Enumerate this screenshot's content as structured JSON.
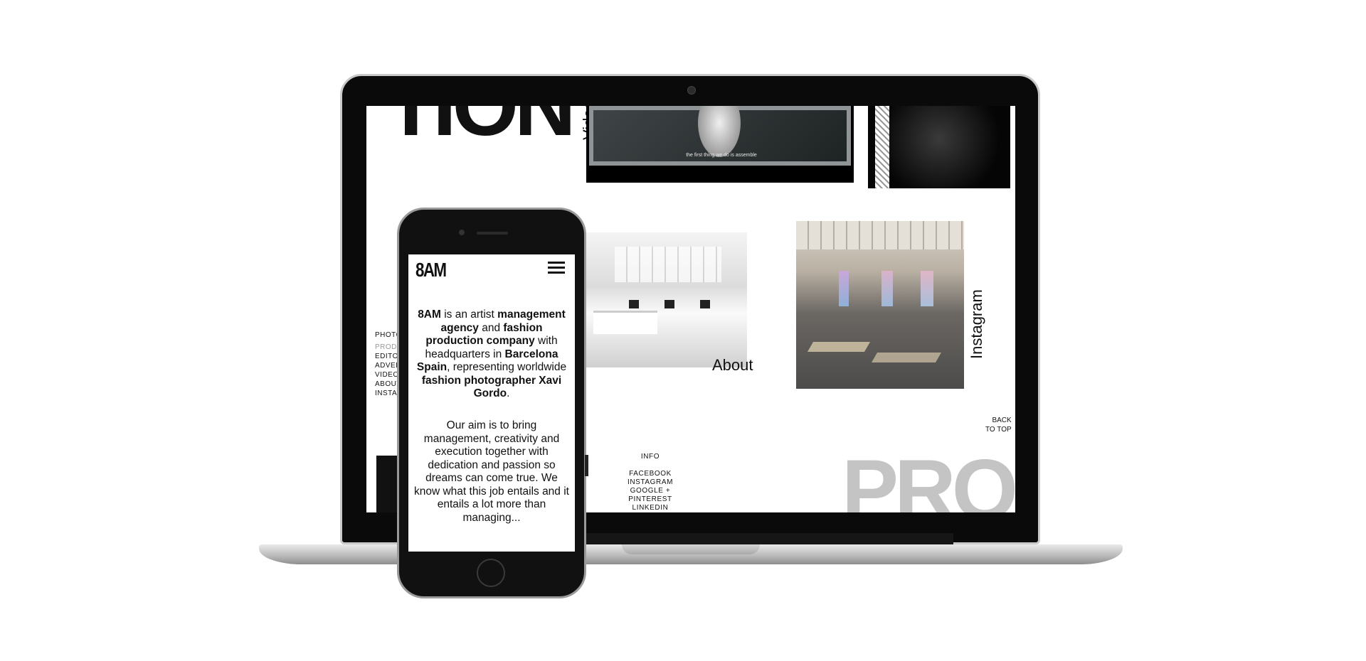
{
  "laptop_site": {
    "top_heading": "TION",
    "video_label": "Video",
    "video_caption": "the first thing we do is assemble",
    "nav_items": [
      "PHOTO",
      "PROD",
      "EDITO",
      "ADVER",
      "VIDEO",
      "ABOUT",
      "INSTAG"
    ],
    "about_label": "About",
    "instagram_label": "Instagram",
    "back_to_top": [
      "BACK",
      "TO TOP"
    ],
    "info_label": "INFO",
    "social_links": [
      "FACEBOOK",
      "INSTAGRAM",
      "GOOGLE +",
      "PINTEREST",
      "LINKEDIN"
    ],
    "bottom_heading": "PRO"
  },
  "phone_site": {
    "logo": "8AM",
    "para1": {
      "p1": "8AM",
      "p2": " is an artist ",
      "p3": "management agency",
      "p4": " and ",
      "p5": "fashion production company",
      "p6": " with headquarters in ",
      "p7": "Barcelona Spain",
      "p8": ", representing worldwide ",
      "p9": "fashion photographer Xavi Gordo",
      "p10": "."
    },
    "para2": "Our aim is to bring management, creativity and execution together with dedication and passion so dreams can come true. We know what this job entails and it entails a lot more than managing..."
  }
}
